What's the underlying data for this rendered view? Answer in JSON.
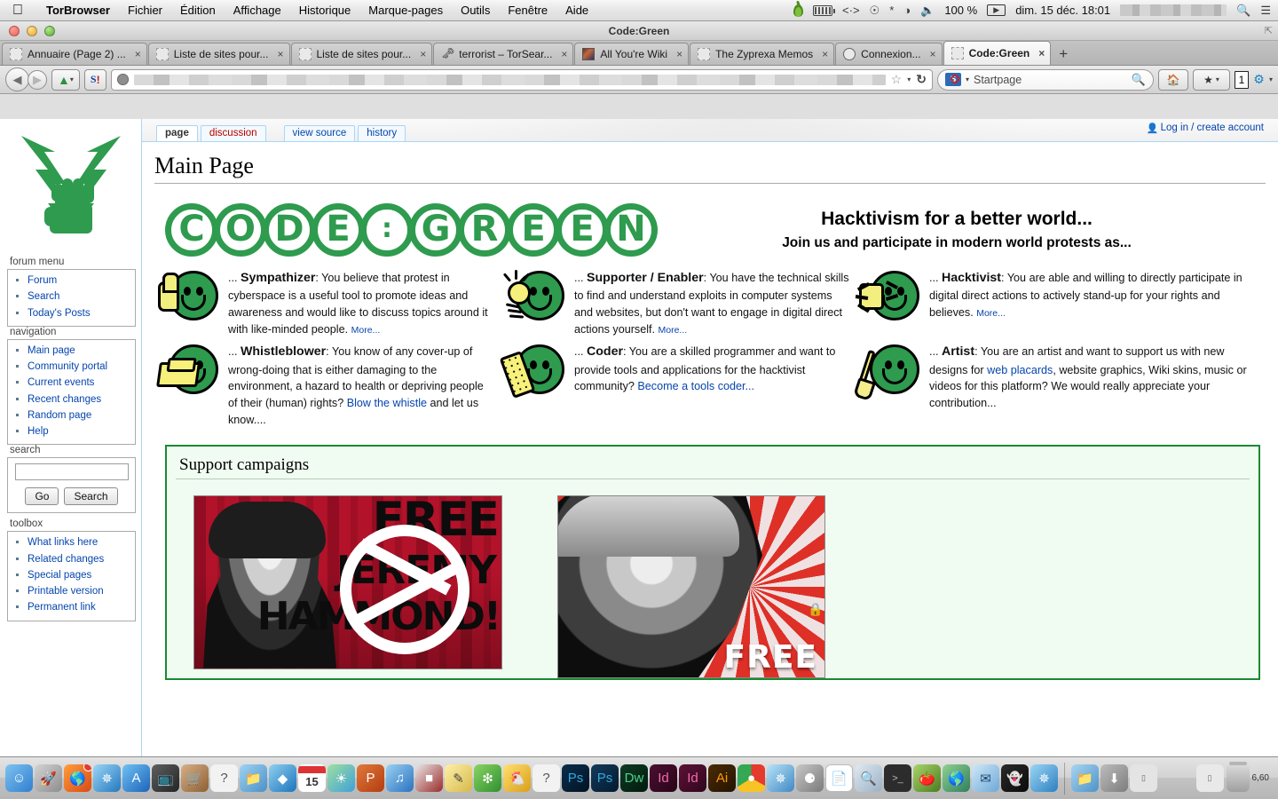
{
  "menubar": {
    "apple_icon": "apple-icon",
    "app_name": "TorBrowser",
    "items": [
      "Fichier",
      "Édition",
      "Affichage",
      "Historique",
      "Marque-pages",
      "Outils",
      "Fenêtre",
      "Aide"
    ],
    "status_icons": [
      "tor-onion-icon",
      "battery-icon",
      "code-icon",
      "clock-icon",
      "bluetooth-icon",
      "wifi-icon",
      "volume-icon"
    ],
    "battery_percent": "100 %",
    "power_icon": "power-plug-icon",
    "datetime": "dim. 15 déc.  18:01",
    "user_redacted": "",
    "spotlight_icon": "search-icon",
    "notifications_icon": "notification-center-icon"
  },
  "window": {
    "title": "Code:Green",
    "traffic_lights": [
      "close-button",
      "minimize-button",
      "zoom-button"
    ],
    "resize_icon": "resize-icon"
  },
  "tabs": [
    {
      "label": "Annuaire (Page 2) ...",
      "favicon": "blank-favicon",
      "active": false
    },
    {
      "label": "Liste de sites pour...",
      "favicon": "blank-favicon",
      "active": false
    },
    {
      "label": "Liste de sites pour...",
      "favicon": "blank-favicon",
      "active": false
    },
    {
      "label": "terrorist – TorSear...",
      "favicon": "key-favicon",
      "active": false
    },
    {
      "label": "All You're Wiki",
      "favicon": "image-favicon",
      "active": false
    },
    {
      "label": "The Zyprexa Memos",
      "favicon": "blank-favicon",
      "active": false
    },
    {
      "label": "Connexion...",
      "favicon": "circle-favicon",
      "active": false
    },
    {
      "label": "Code:Green",
      "favicon": "blank-favicon",
      "active": true
    }
  ],
  "tab_close_label": "×",
  "new_tab_label": "+",
  "toolbar": {
    "back_icon": "back-arrow-icon",
    "forward_icon": "forward-arrow-icon",
    "torbutton_icon": "torbutton-icon",
    "torbutton_caret": "▾",
    "scriptsafe_icon": "scriptsafe-icon",
    "url_value": "",
    "url_globe_icon": "globe-icon",
    "bookmark_star_icon": "star-icon",
    "bookmark_caret": "▾",
    "reload_icon": "reload-icon",
    "search_engine": "Startpage",
    "search_engine_caret": "▾",
    "search_magnifier_icon": "search-icon",
    "home_icon": "home-icon",
    "bookmarks_icon": "bookmarks-icon",
    "bookmarks_caret": "▾",
    "tab_count": "1",
    "noscript_icon": "noscript-icon",
    "noscript_caret": "▾"
  },
  "sidebar": {
    "logo_icon": "codegreen-fist-logo",
    "portlets": [
      {
        "title": "forum menu",
        "items": [
          "Forum",
          "Search",
          "Today's Posts"
        ]
      },
      {
        "title": "navigation",
        "items": [
          "Main page",
          "Community portal",
          "Current events",
          "Recent changes",
          "Random page",
          "Help"
        ]
      }
    ],
    "search": {
      "title": "search",
      "value": "",
      "go_label": "Go",
      "search_label": "Search"
    },
    "toolbox": {
      "title": "toolbox",
      "items": [
        "What links here",
        "Related changes",
        "Special pages",
        "Printable version",
        "Permanent link"
      ]
    }
  },
  "content": {
    "tabs": [
      {
        "label": "page",
        "state": "selected"
      },
      {
        "label": "discussion",
        "state": "new"
      },
      {
        "label": "view source",
        "state": "normal"
      },
      {
        "label": "history",
        "state": "normal"
      }
    ],
    "login_text": "Log in / create account",
    "user_icon": "user-icon",
    "page_title": "Main Page",
    "logo_text": "CODE:GREEN",
    "logo_letters": [
      "C",
      "O",
      "D",
      "E",
      ":",
      "G",
      "R",
      "E",
      "E",
      "N"
    ],
    "tagline_1": "Hacktivism for a better world...",
    "tagline_2": "Join us and participate in modern world protests as...",
    "roles": [
      {
        "icon": "thumbs-up-smiley-icon",
        "prefix": "... ",
        "title": "Sympathizer",
        "colon": ":",
        "body": "You believe that protest in cyberspace is a useful tool to promote ideas and awareness and would like to discuss topics around it with like-minded people.",
        "link": "More...",
        "tail": ""
      },
      {
        "icon": "lightbulb-smiley-icon",
        "prefix": "... ",
        "title": "Supporter / Enabler",
        "colon": ":",
        "body": "You have the technical skills to find and understand exploits in computer systems and websites, but don't want to engage in digital direct actions yourself.",
        "link": "More...",
        "tail": ""
      },
      {
        "icon": "fist-bolt-smiley-icon",
        "prefix": "... ",
        "title": "Hacktivist",
        "colon": ":",
        "body": "You are able and willing to directly participate in digital direct actions to actively stand-up for your rights and believes.",
        "link": "More...",
        "tail": ""
      },
      {
        "icon": "whistle-smiley-icon",
        "prefix": "... ",
        "title": "Whistleblower",
        "colon": ":",
        "body": "You know of any cover-up of wrong-doing that is either damaging to the environment, a hazard to health or depriving people of their (human) rights?",
        "link": "Blow the whistle",
        "tail": " and let us know...."
      },
      {
        "icon": "phone-smiley-icon",
        "prefix": "... ",
        "title": "Coder",
        "colon": ":",
        "body": "You are a skilled programmer and want to provide tools and applications for the hacktivist community?",
        "link": "Become a tools coder...",
        "tail": ""
      },
      {
        "icon": "paintbrush-smiley-icon",
        "prefix": "... ",
        "title": "Artist",
        "colon": ":",
        "body_before": "You are an artist and want to support us with new designs for ",
        "link": "web placards",
        "body_after": ", website graphics, Wiki skins, music or videos for this platform? We would really appreciate your contribution...",
        "body": "",
        "tail": ""
      }
    ],
    "campaigns": {
      "heading": "Support campaigns",
      "posters": [
        {
          "name": "free-jeremy-hammond-poster",
          "line1": "FREE",
          "line2": "JEREMY",
          "line3": "HAMMOND!"
        },
        {
          "name": "free-poster",
          "line1": "FREE"
        }
      ],
      "lock_icon": "lock-icon"
    }
  },
  "dock": {
    "items": [
      "finder-icon",
      "launchpad-icon",
      "firefox-icon",
      "safari-icon",
      "appstore-icon",
      "tv-icon",
      "store-icon",
      "help-icon",
      "folder-icon",
      "dropbox-icon",
      "calendar-icon",
      "photos-icon",
      "powerpoint-icon",
      "itunes-icon",
      "keynote-icon",
      "notes-icon",
      "utorrent-icon",
      "duck-icon",
      "help2-icon",
      "photoshop-icon",
      "photoshop2-icon",
      "dreamweaver-icon",
      "indesign-icon",
      "indesign2-icon",
      "illustrator-icon",
      "chrome-icon",
      "compass-icon",
      "safari2-icon",
      "document-icon",
      "preview-icon",
      "terminal-icon",
      "onion-icon",
      "world-icon",
      "mail-icon",
      "anonymous-icon",
      "torbrowser-icon",
      "folder2-icon",
      "downloads-icon",
      "minimized-window-icon"
    ],
    "calendar_day": "15",
    "trash_icon": "trash-icon",
    "time_label": "6,60"
  }
}
